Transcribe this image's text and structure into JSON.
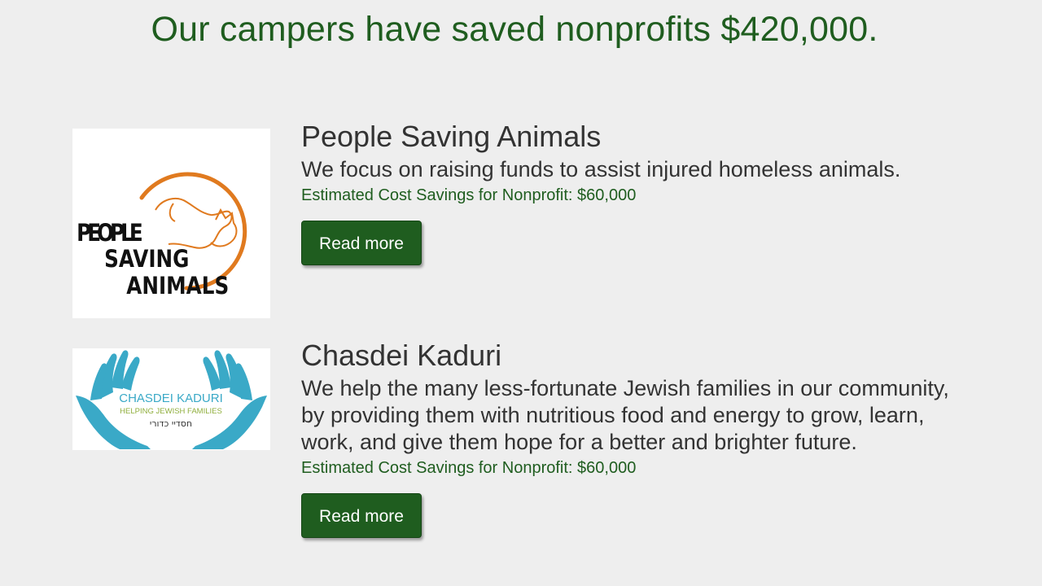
{
  "headline": "Our campers have saved nonprofits $420,000.",
  "organizations": [
    {
      "name": "People Saving Animals",
      "description": "We focus on raising funds to assist injured homeless animals.",
      "savings": "Estimated Cost Savings for Nonprofit: $60,000",
      "button_label": "Read more",
      "logo": {
        "lines": [
          "PEOPLE",
          "SAVING",
          "ANIMALS"
        ],
        "accent_color": "#e07a1f",
        "text_color": "#111111"
      }
    },
    {
      "name": "Chasdei Kaduri",
      "description": "We help the many less-fortunate Jewish families in our community, by providing them with nutritious food and energy to grow, learn, work, and give them hope for a better and brighter future.",
      "savings": "Estimated Cost Savings for Nonprofit: $60,000",
      "button_label": "Read more",
      "logo": {
        "title": "CHASDEI KADURI",
        "subtitle": "HELPING JEWISH FAMILIES",
        "hebrew": "חסדיי כדורי",
        "hand_color": "#3aa9c7",
        "subtitle_color": "#8fae3c"
      }
    }
  ],
  "colors": {
    "background": "#eeeeee",
    "brand_green": "#1f5d1f",
    "text": "#333333"
  }
}
